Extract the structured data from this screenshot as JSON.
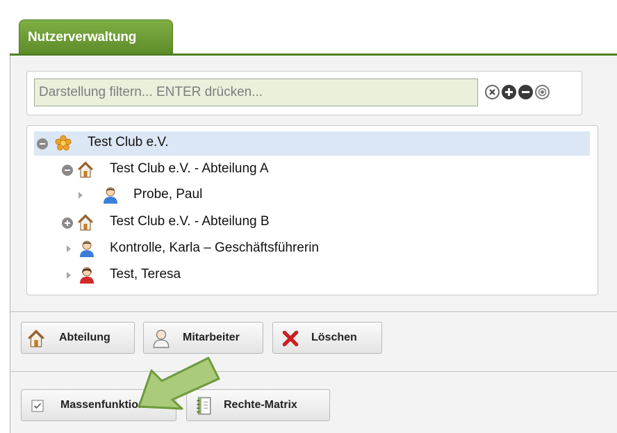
{
  "tab": {
    "label": "Nutzerverwaltung"
  },
  "filter": {
    "placeholder": "Darstellung filtern... ENTER drücken..."
  },
  "tree": {
    "items": [
      {
        "label": "Test Club e.V.",
        "icon": "club-icon"
      },
      {
        "label": "Test Club e.V. - Abteilung A",
        "icon": "house-icon"
      },
      {
        "label": "Probe, Paul",
        "icon": "user-icon"
      },
      {
        "label": "Test Club e.V. - Abteilung B",
        "icon": "house-icon"
      },
      {
        "label": "Kontrolle, Karla – Geschäftsführerin",
        "icon": "user-icon"
      },
      {
        "label": "Test, Teresa",
        "icon": "user-female-icon"
      }
    ]
  },
  "toolbar": {
    "abteilung_label": "Abteilung",
    "mitarbeiter_label": "Mitarbeiter",
    "loeschen_label": "Löschen"
  },
  "bottom": {
    "massenfunktion_label": "Massenfunktion",
    "rechte_matrix_label": "Rechte-Matrix"
  },
  "colors": {
    "accent_green": "#6a9a33",
    "selection": "#dce7f5",
    "delete_red": "#cc1f1f",
    "arrow_green": "#a9cb7a"
  }
}
